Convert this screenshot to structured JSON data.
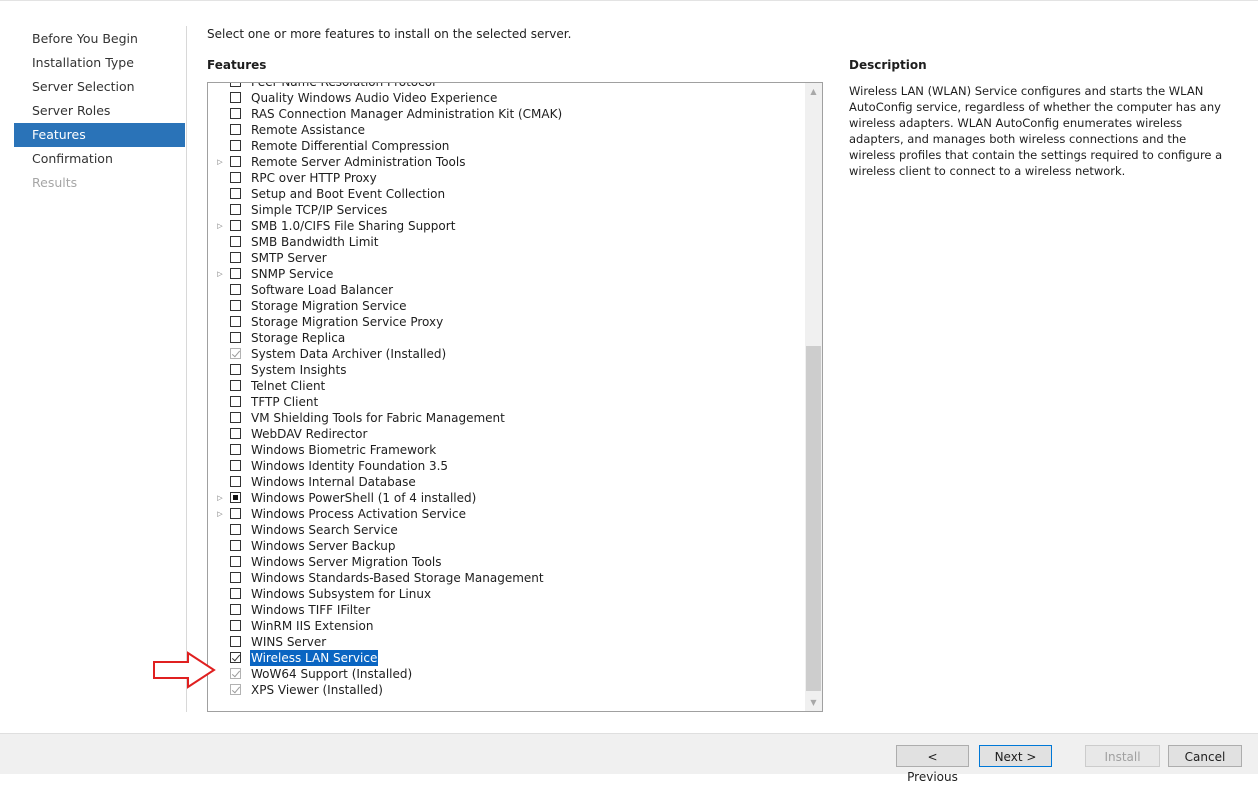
{
  "nav": {
    "items": [
      {
        "label": "Before You Begin",
        "state": "normal"
      },
      {
        "label": "Installation Type",
        "state": "normal"
      },
      {
        "label": "Server Selection",
        "state": "normal"
      },
      {
        "label": "Server Roles",
        "state": "normal"
      },
      {
        "label": "Features",
        "state": "active"
      },
      {
        "label": "Confirmation",
        "state": "normal"
      },
      {
        "label": "Results",
        "state": "disabled"
      }
    ]
  },
  "main": {
    "instruction": "Select one or more features to install on the selected server.",
    "features_label": "Features"
  },
  "features": [
    {
      "label": "Peer Name Resolution Protocol",
      "state": "unchecked",
      "expandable": false
    },
    {
      "label": "Quality Windows Audio Video Experience",
      "state": "unchecked",
      "expandable": false
    },
    {
      "label": "RAS Connection Manager Administration Kit (CMAK)",
      "state": "unchecked",
      "expandable": false
    },
    {
      "label": "Remote Assistance",
      "state": "unchecked",
      "expandable": false
    },
    {
      "label": "Remote Differential Compression",
      "state": "unchecked",
      "expandable": false
    },
    {
      "label": "Remote Server Administration Tools",
      "state": "unchecked",
      "expandable": true
    },
    {
      "label": "RPC over HTTP Proxy",
      "state": "unchecked",
      "expandable": false
    },
    {
      "label": "Setup and Boot Event Collection",
      "state": "unchecked",
      "expandable": false
    },
    {
      "label": "Simple TCP/IP Services",
      "state": "unchecked",
      "expandable": false
    },
    {
      "label": "SMB 1.0/CIFS File Sharing Support",
      "state": "unchecked",
      "expandable": true
    },
    {
      "label": "SMB Bandwidth Limit",
      "state": "unchecked",
      "expandable": false
    },
    {
      "label": "SMTP Server",
      "state": "unchecked",
      "expandable": false
    },
    {
      "label": "SNMP Service",
      "state": "unchecked",
      "expandable": true
    },
    {
      "label": "Software Load Balancer",
      "state": "unchecked",
      "expandable": false
    },
    {
      "label": "Storage Migration Service",
      "state": "unchecked",
      "expandable": false
    },
    {
      "label": "Storage Migration Service Proxy",
      "state": "unchecked",
      "expandable": false
    },
    {
      "label": "Storage Replica",
      "state": "unchecked",
      "expandable": false
    },
    {
      "label": "System Data Archiver (Installed)",
      "state": "installed",
      "expandable": false
    },
    {
      "label": "System Insights",
      "state": "unchecked",
      "expandable": false
    },
    {
      "label": "Telnet Client",
      "state": "unchecked",
      "expandable": false
    },
    {
      "label": "TFTP Client",
      "state": "unchecked",
      "expandable": false
    },
    {
      "label": "VM Shielding Tools for Fabric Management",
      "state": "unchecked",
      "expandable": false
    },
    {
      "label": "WebDAV Redirector",
      "state": "unchecked",
      "expandable": false
    },
    {
      "label": "Windows Biometric Framework",
      "state": "unchecked",
      "expandable": false
    },
    {
      "label": "Windows Identity Foundation 3.5",
      "state": "unchecked",
      "expandable": false
    },
    {
      "label": "Windows Internal Database",
      "state": "unchecked",
      "expandable": false
    },
    {
      "label": "Windows PowerShell (1 of 4 installed)",
      "state": "partial",
      "expandable": true
    },
    {
      "label": "Windows Process Activation Service",
      "state": "unchecked",
      "expandable": true
    },
    {
      "label": "Windows Search Service",
      "state": "unchecked",
      "expandable": false
    },
    {
      "label": "Windows Server Backup",
      "state": "unchecked",
      "expandable": false
    },
    {
      "label": "Windows Server Migration Tools",
      "state": "unchecked",
      "expandable": false
    },
    {
      "label": "Windows Standards-Based Storage Management",
      "state": "unchecked",
      "expandable": false
    },
    {
      "label": "Windows Subsystem for Linux",
      "state": "unchecked",
      "expandable": false
    },
    {
      "label": "Windows TIFF IFilter",
      "state": "unchecked",
      "expandable": false
    },
    {
      "label": "WinRM IIS Extension",
      "state": "unchecked",
      "expandable": false
    },
    {
      "label": "WINS Server",
      "state": "unchecked",
      "expandable": false
    },
    {
      "label": "Wireless LAN Service",
      "state": "checked",
      "expandable": false,
      "selected": true
    },
    {
      "label": "WoW64 Support (Installed)",
      "state": "installed",
      "expandable": false
    },
    {
      "label": "XPS Viewer (Installed)",
      "state": "installed",
      "expandable": false
    }
  ],
  "description": {
    "title": "Description",
    "text": "Wireless LAN (WLAN) Service configures and starts the WLAN AutoConfig service, regardless of whether the computer has any wireless adapters. WLAN AutoConfig enumerates wireless adapters, and manages both wireless connections and the wireless profiles that contain the settings required to configure a wireless client to connect to a wireless network."
  },
  "footer": {
    "previous": "< Previous",
    "next": "Next >",
    "install": "Install",
    "cancel": "Cancel"
  },
  "icons": {
    "expander": "triangle-right-icon",
    "arrow": "red-arrow-icon",
    "scroll_up": "chevron-up-icon",
    "scroll_down": "chevron-down-icon"
  },
  "colors": {
    "accent": "#2a73b8",
    "selection": "#0a65c2",
    "annotation_arrow": "#e02020"
  }
}
